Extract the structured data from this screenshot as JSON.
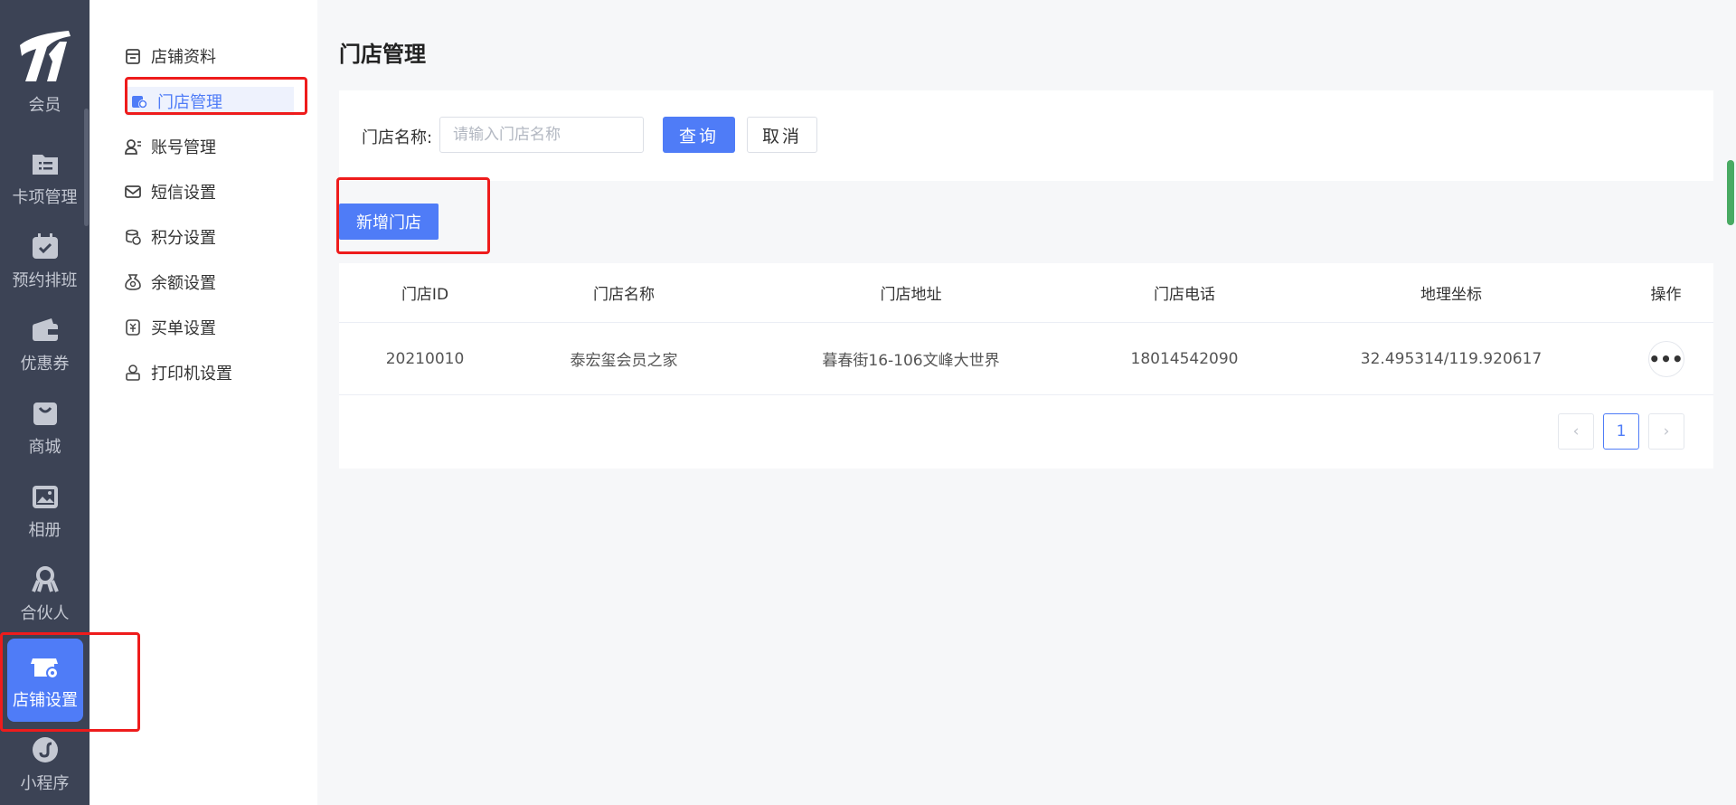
{
  "rail": {
    "items": [
      {
        "label": "会员",
        "icon": "member-icon"
      },
      {
        "label": "卡项管理",
        "icon": "card-icon"
      },
      {
        "label": "预约排班",
        "icon": "calendar-icon"
      },
      {
        "label": "优惠券",
        "icon": "coupon-icon"
      },
      {
        "label": "商城",
        "icon": "bag-icon"
      },
      {
        "label": "相册",
        "icon": "image-icon"
      },
      {
        "label": "合伙人",
        "icon": "partner-icon"
      },
      {
        "label": "店铺设置",
        "icon": "store-settings-icon",
        "active": true
      },
      {
        "label": "小程序",
        "icon": "miniprogram-icon"
      }
    ]
  },
  "submenu": {
    "items": [
      {
        "label": "店铺资料",
        "icon": "shop-info-icon"
      },
      {
        "label": "门店管理",
        "icon": "store-manage-icon",
        "active": true
      },
      {
        "label": "账号管理",
        "icon": "account-icon"
      },
      {
        "label": "短信设置",
        "icon": "sms-icon"
      },
      {
        "label": "积分设置",
        "icon": "points-icon"
      },
      {
        "label": "余额设置",
        "icon": "balance-icon"
      },
      {
        "label": "买单设置",
        "icon": "checkout-icon"
      },
      {
        "label": "打印机设置",
        "icon": "printer-icon"
      }
    ]
  },
  "page": {
    "title": "门店管理"
  },
  "filter": {
    "label": "门店名称:",
    "placeholder": "请输入门店名称",
    "value": "",
    "query_label": "查询",
    "cancel_label": "取消"
  },
  "actions": {
    "add_label": "新增门店"
  },
  "table": {
    "columns": [
      "门店ID",
      "门店名称",
      "门店地址",
      "门店电话",
      "地理坐标",
      "操作"
    ],
    "rows": [
      [
        "20210010",
        "泰宏玺会员之家",
        "暮春街16-106文峰大世界",
        "18014542090",
        "32.495314/119.920617"
      ]
    ]
  },
  "pagination": {
    "current": "1",
    "prev_symbol": "‹",
    "next_symbol": "›"
  },
  "colors": {
    "accent": "#4f7cf7",
    "rail_bg": "#3c4355",
    "highlight_red": "#ee1c1c"
  }
}
